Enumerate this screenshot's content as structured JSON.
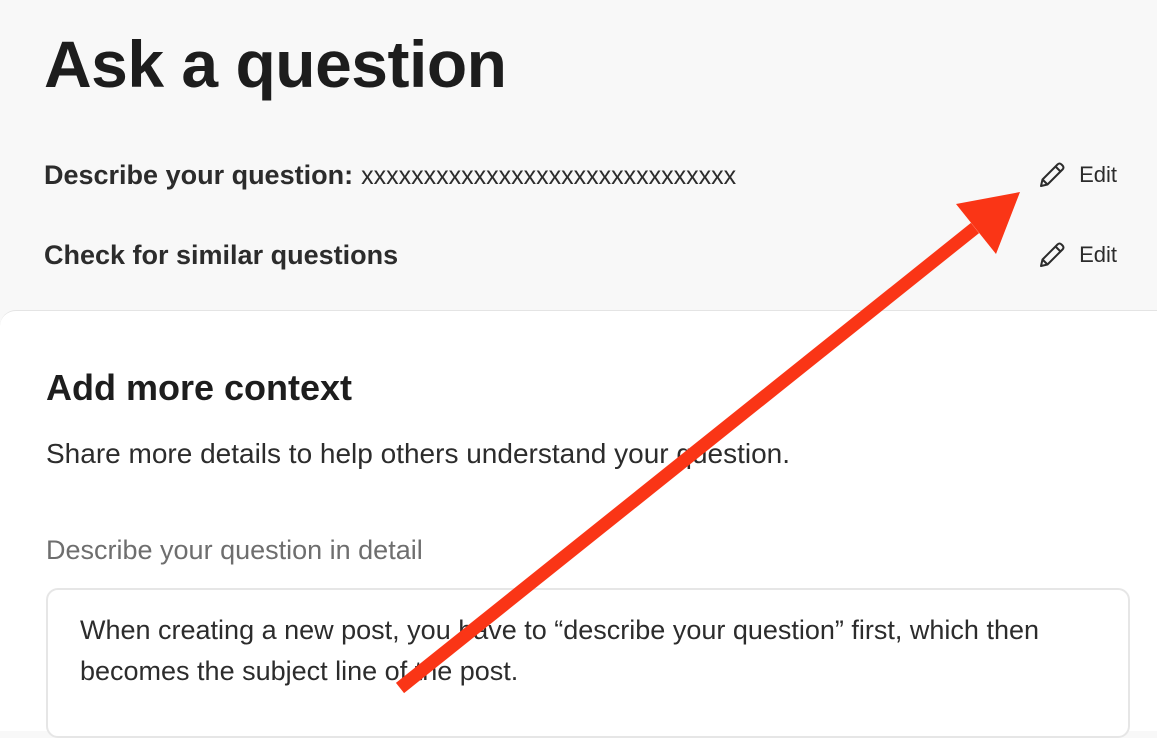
{
  "page": {
    "title": "Ask a question"
  },
  "steps": [
    {
      "label": "Describe your question:",
      "value": "xxxxxxxxxxxxxxxxxxxxxxxxxxxxxx",
      "edit_label": "Edit",
      "edit_icon": "pencil-icon"
    },
    {
      "label": "Check for similar questions",
      "edit_label": "Edit",
      "edit_icon": "pencil-icon"
    }
  ],
  "context": {
    "title": "Add more context",
    "subtitle": "Share more details to help others understand your question.",
    "detail_label": "Describe your question in detail",
    "detail_value": "When creating a new post, you have to “describe your question” first, which then becomes the subject line of the post."
  },
  "annotation": {
    "type": "arrow",
    "color": "#fa3516"
  }
}
